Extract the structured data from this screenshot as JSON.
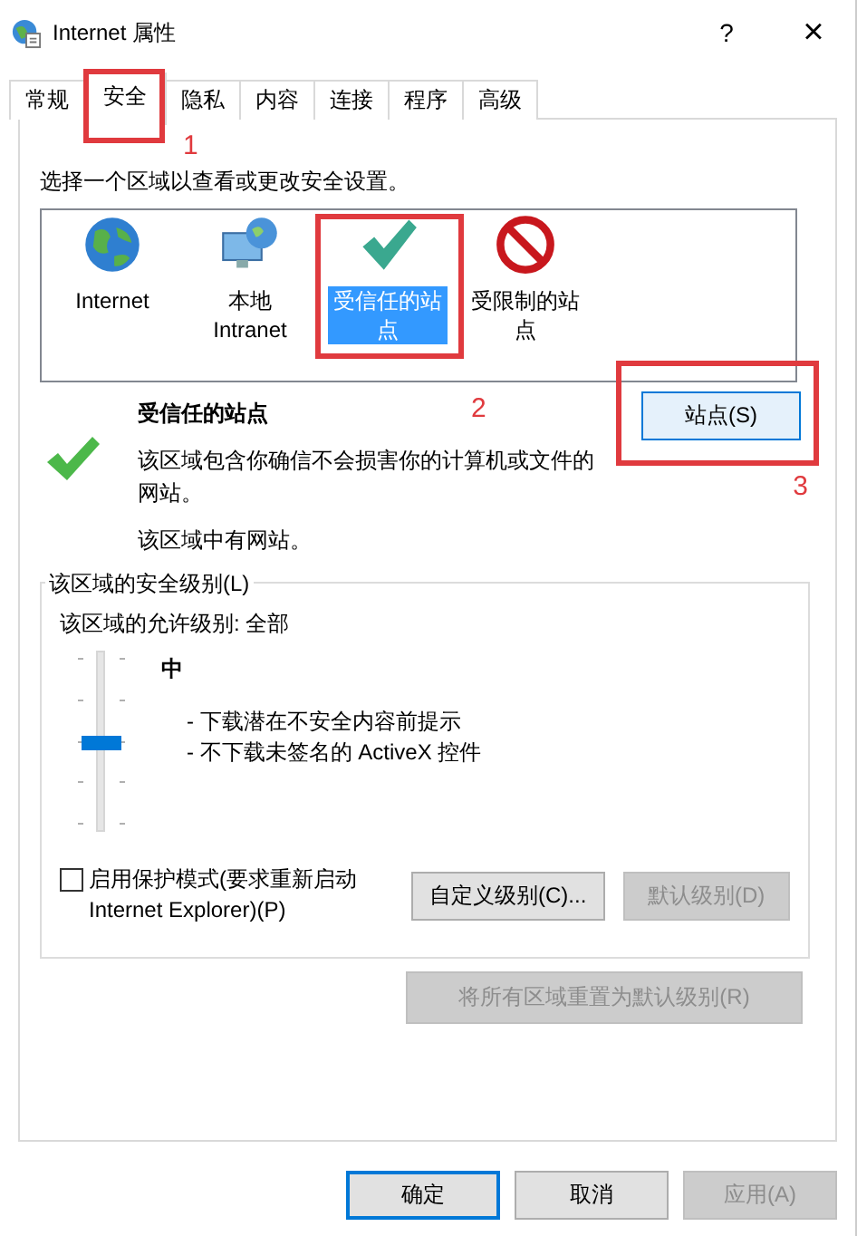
{
  "window": {
    "title": "Internet 属性",
    "help": "?",
    "close": "×"
  },
  "tabs": [
    {
      "label": "常规",
      "selected": false
    },
    {
      "label": "安全",
      "selected": true,
      "annotation": "1"
    },
    {
      "label": "隐私",
      "selected": false
    },
    {
      "label": "内容",
      "selected": false
    },
    {
      "label": "连接",
      "selected": false
    },
    {
      "label": "程序",
      "selected": false
    },
    {
      "label": "高级",
      "selected": false
    }
  ],
  "prompt": "选择一个区域以查看或更改安全设置。",
  "zones": [
    {
      "label": "Internet",
      "kind": "globe",
      "selected": false
    },
    {
      "label": "本地 Intranet",
      "kind": "intranet",
      "selected": false
    },
    {
      "label": "受信任的站点",
      "kind": "trusted",
      "selected": true,
      "annotation": "2"
    },
    {
      "label": "受限制的站点",
      "kind": "restricted",
      "selected": false
    }
  ],
  "zone_info": {
    "title": "受信任的站点",
    "description": "该区域包含你确信不会损害你的计算机或文件的网站。",
    "note": "该区域中有网站。",
    "sites_button": {
      "label": "站点(S)",
      "annotation": "3"
    }
  },
  "security_level": {
    "legend": "该区域的安全级别(L)",
    "allowed": "该区域的允许级别: 全部",
    "slider": {
      "level": 0.5
    },
    "level_name": "中",
    "bullets": [
      "- 下载潜在不安全内容前提示",
      "- 不下载未签名的 ActiveX 控件"
    ],
    "protected_mode": {
      "label": "启用保护模式(要求重新启动 Internet Explorer)(P)",
      "checked": false
    },
    "buttons": [
      {
        "label": "自定义级别(C)...",
        "disabled": false
      },
      {
        "label": "默认级别(D)",
        "disabled": true
      }
    ]
  },
  "reset_button": {
    "label": "将所有区域重置为默认级别(R)",
    "disabled": true
  },
  "dialog_buttons": [
    {
      "label": "确定",
      "disabled": false,
      "default": true
    },
    {
      "label": "取消",
      "disabled": false,
      "default": false
    },
    {
      "label": "应用(A)",
      "disabled": true,
      "default": false
    }
  ]
}
